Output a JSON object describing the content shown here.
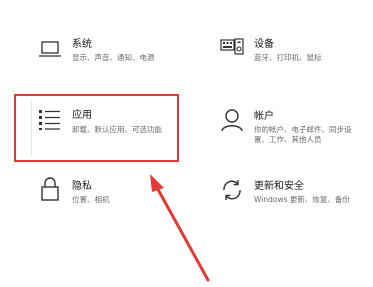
{
  "tiles": {
    "system": {
      "title": "系统",
      "desc": "显示、声音、通知、电源",
      "icon": "laptop-icon"
    },
    "devices": {
      "title": "设备",
      "desc": "蓝牙、打印机、鼠标",
      "icon": "keyboard-devices-icon"
    },
    "apps": {
      "title": "应用",
      "desc": "卸载、默认应用、可选功能",
      "icon": "apps-list-icon"
    },
    "accounts": {
      "title": "帐户",
      "desc_line1": "你的帐户、电子邮件、同步设",
      "desc_line2": "置、工作、其他人员",
      "icon": "person-icon"
    },
    "privacy": {
      "title": "隐私",
      "desc": "位置、相机",
      "icon": "lock-icon"
    },
    "update": {
      "title": "更新和安全",
      "desc": "Windows 更新、恢复、备份",
      "icon": "sync-icon"
    }
  },
  "colors": {
    "highlight": "#e53935",
    "arrow": "#e53935"
  }
}
